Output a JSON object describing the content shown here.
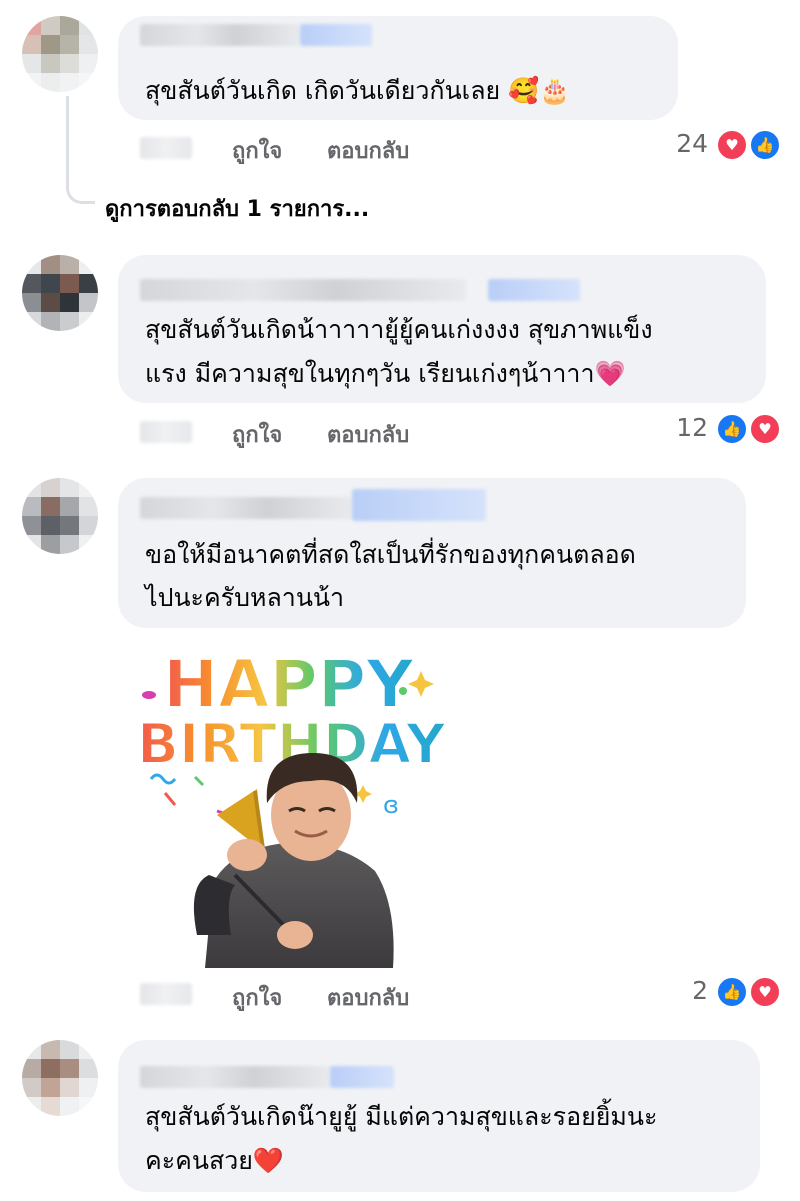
{
  "comments": [
    {
      "text_lines": [
        "สุขสันต์วันเกิด เกิดวันเดียวกันเลย 🥰🎂"
      ],
      "like_label": "ถูกใจ",
      "reply_label": "ตอบกลับ",
      "reaction_count": "24",
      "reactions": [
        "love",
        "like"
      ]
    },
    {
      "text_lines": [
        "สุขสันต์วันเกิดน้าาาาายู้ยู้คนเก่งงงง  สุขภาพแข็ง",
        "แรง มีความสุขในทุกๆวัน เรียนเก่งๆน้าาาา💗"
      ],
      "like_label": "ถูกใจ",
      "reply_label": "ตอบกลับ",
      "reaction_count": "12",
      "reactions": [
        "like",
        "love"
      ]
    },
    {
      "text_lines": [
        "ขอให้มีอนาคตที่สดใสเป็นที่รักของทุกคนตลอด",
        "ไปนะครับหลานน้า"
      ],
      "sticker_text_line1": "HAPPY",
      "sticker_text_line2": "BIRTHDAY",
      "like_label": "ถูกใจ",
      "reply_label": "ตอบกลับ",
      "reaction_count": "2",
      "reactions": [
        "like",
        "love"
      ]
    },
    {
      "text_lines": [
        "สุขสันต์วันเกิดน๊ายูยู้ มีแต่ความสุขและรอยยิ้มนะ",
        "คะคนสวย❤️"
      ]
    }
  ],
  "view_replies_label": "ดูการตอบกลับ 1 รายการ...",
  "colors": {
    "bubble": "#f0f2f5",
    "meta_text": "#65676b",
    "like_blue": "#1877f2",
    "love_red": "#f33e58"
  }
}
